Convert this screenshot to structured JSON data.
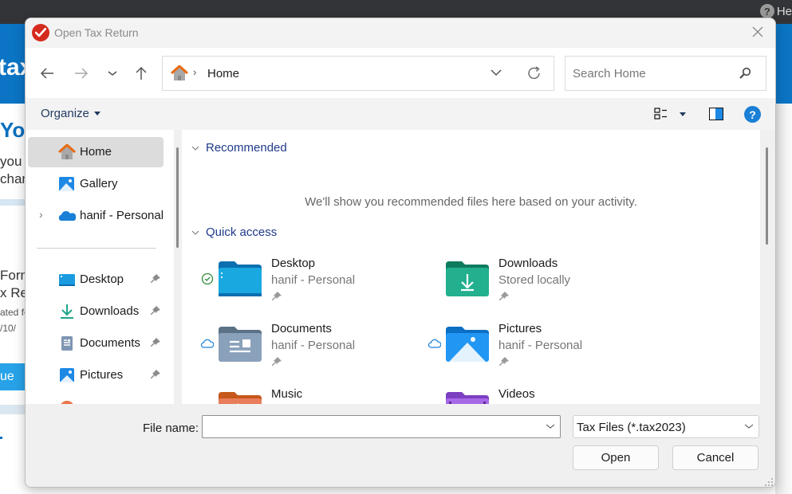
{
  "background_app": {
    "help_label": "He",
    "logo_fragment": "tax",
    "heading_fragment": "Yo",
    "text_lines_1": [
      "you",
      "chan"
    ],
    "text_lines_2": [
      "Form",
      "x Re"
    ],
    "small_lines": [
      "ated fo",
      "/10/"
    ],
    "button_fragment": "ue"
  },
  "dialog": {
    "title": "Open Tax Return",
    "close_label": "✕"
  },
  "navbar": {
    "address_crumb": "Home",
    "search_placeholder": "Search Home"
  },
  "commandbar": {
    "organize_label": "Organize",
    "help_label": "?"
  },
  "leftnav": {
    "items": [
      {
        "label": "Home",
        "icon": "home-icon",
        "selected": true
      },
      {
        "label": "Gallery",
        "icon": "gallery-icon"
      },
      {
        "label": "hanif - Personal",
        "icon": "onedrive-cloud-icon",
        "expandable": true
      },
      {
        "label": "Desktop",
        "icon": "desktop-folder-icon",
        "pinned": true
      },
      {
        "label": "Downloads",
        "icon": "download-icon",
        "pinned": true
      },
      {
        "label": "Documents",
        "icon": "documents-icon",
        "pinned": true
      },
      {
        "label": "Pictures",
        "icon": "pictures-icon",
        "pinned": true
      }
    ]
  },
  "main": {
    "recommended_header": "Recommended",
    "recommended_empty": "We'll show you recommended files here based on your activity.",
    "quick_access_header": "Quick access",
    "quick_access": [
      {
        "name": "Desktop",
        "location": "hanif - Personal",
        "status": "synced",
        "color": "#1a9be0"
      },
      {
        "name": "Downloads",
        "location": "Stored locally",
        "status": "none",
        "color": "#1fa68a"
      },
      {
        "name": "Documents",
        "location": "hanif - Personal",
        "status": "cloud",
        "color": "#7f96b3"
      },
      {
        "name": "Pictures",
        "location": "hanif - Personal",
        "status": "cloud",
        "color": "#1e88e5"
      },
      {
        "name": "Music",
        "location": "",
        "status": "none",
        "color": "#e87448"
      },
      {
        "name": "Videos",
        "location": "",
        "status": "none",
        "color": "#9b5bd6"
      }
    ]
  },
  "bottom": {
    "file_name_label": "File name:",
    "file_name_value": "",
    "file_type_value": "Tax Files (*.tax2023)",
    "open_label": "Open",
    "cancel_label": "Cancel"
  },
  "colors": {
    "accent": "#1f3a8a",
    "brand_blue": "#0b74c4",
    "app_icon_red": "#d52b1e"
  }
}
